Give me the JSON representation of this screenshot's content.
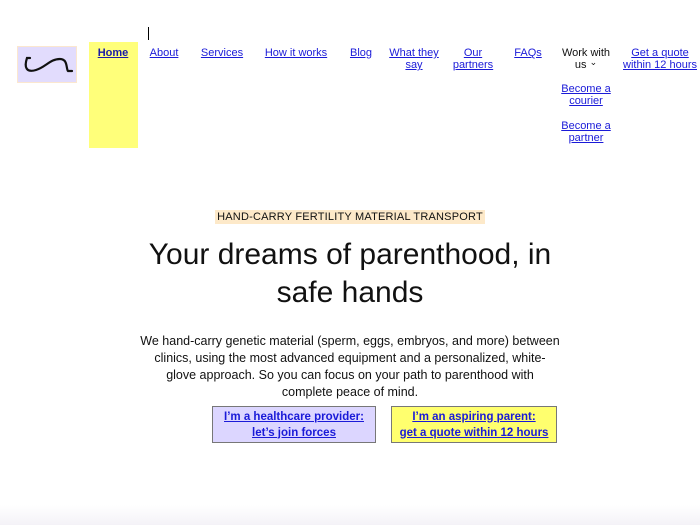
{
  "nav": {
    "home": "Home",
    "about": "About",
    "services": "Services",
    "how_it_works": "How it works",
    "blog": "Blog",
    "what_they_say": [
      "What they",
      "say"
    ],
    "our_partners": [
      "Our",
      "partners"
    ],
    "faqs": "FAQs",
    "work_with_us": [
      "Work with",
      "us"
    ],
    "work_with_us_chevron": "⌄",
    "become_courier": [
      "Become a",
      "courier"
    ],
    "become_partner": [
      "Become a",
      "partner"
    ],
    "get_quote": [
      "Get a quote",
      "within 12 hours"
    ]
  },
  "hero": {
    "eyebrow": "HAND-CARRY FERTILITY MATERIAL TRANSPORT",
    "title": [
      "Your dreams of parenthood, in",
      "safe hands"
    ],
    "lead": "We hand-carry genetic material (sperm, eggs, embryos, and more) between clinics, using the most advanced equipment and a personalized, white-glove approach. So you can focus on your path to parenthood with complete peace of mind.",
    "cta_provider": [
      "I’m a healthcare provider:",
      "let’s join forces"
    ],
    "cta_parent": [
      "I’m an aspiring parent:",
      "get a quote within 12 hours"
    ]
  },
  "colors": {
    "link": "#1a1ad8",
    "yellow": "#ffff7a",
    "lavender": "#dcd6ff",
    "eyebrow_bg": "#fde9c9"
  }
}
